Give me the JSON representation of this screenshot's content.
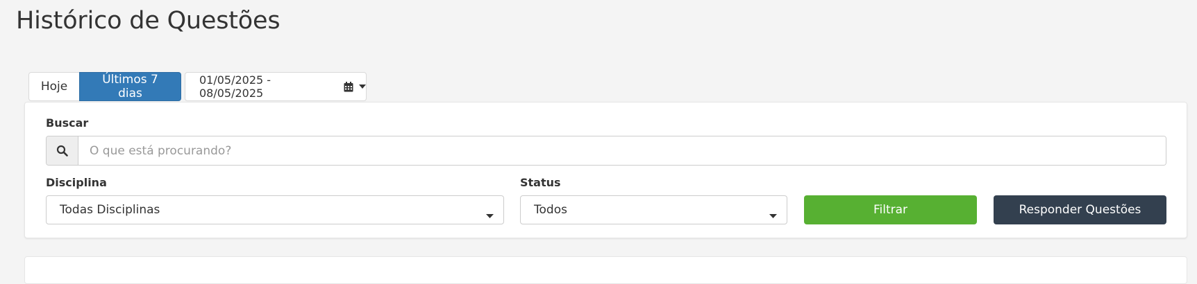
{
  "page": {
    "title": "Histórico de Questões"
  },
  "date_range": {
    "today_label": "Hoje",
    "last7_label": "Últimos 7 dias",
    "range_text": "01/05/2025 - 08/05/2025"
  },
  "filters": {
    "search_label": "Buscar",
    "search_placeholder": "O que está procurando?",
    "discipline_label": "Disciplina",
    "discipline_value": "Todas Disciplinas",
    "status_label": "Status",
    "status_value": "Todos",
    "filter_button": "Filtrar",
    "answer_button": "Responder Questões"
  },
  "colors": {
    "active_tab": "#337ab7",
    "filter_button": "#57b032",
    "answer_button": "#33404f"
  }
}
